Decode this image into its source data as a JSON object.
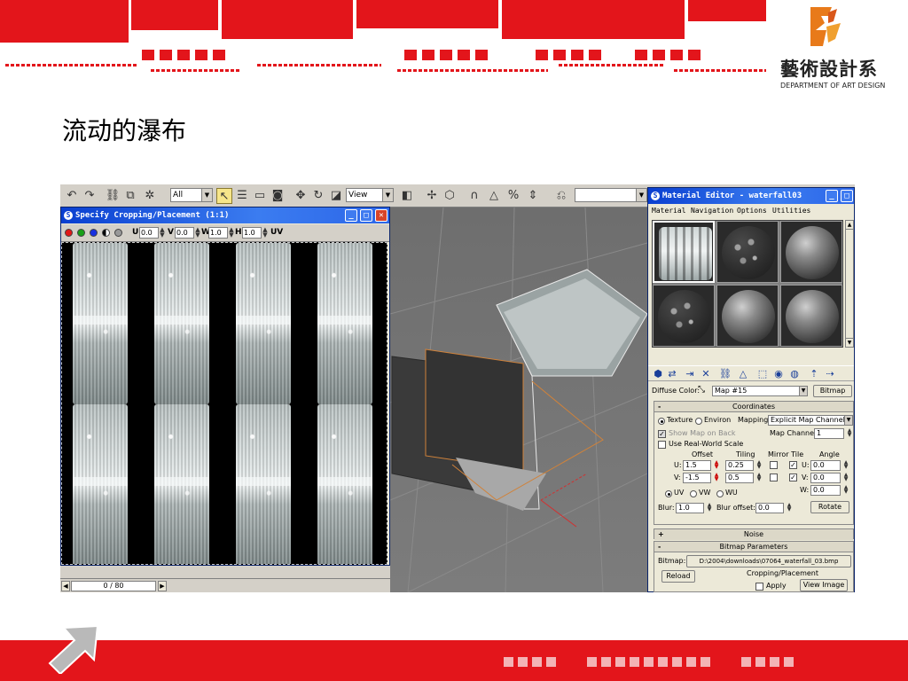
{
  "header": {
    "logo_text": "藝術設計系",
    "logo_subtitle": "DEPARTMENT OF ART DESIGN"
  },
  "slide_title": "流动的瀑布",
  "colors": {
    "brand_red": "#e3151b",
    "titlebar_blue": "#0a3fd0",
    "window_bg": "#ece9d8",
    "toolbar_bg": "#d4d0c8"
  },
  "main_toolbar": {
    "selection_filter": "All",
    "reference_coord": "View",
    "named_selection": ""
  },
  "crop_window": {
    "title": "Specify Cropping/Placement  (1:1)",
    "u_label": "U",
    "u_value": "0.0",
    "v_label": "V",
    "v_value": "0.0",
    "w_label": "W",
    "w_value": "1.0",
    "h_label": "H",
    "h_value": "1.0",
    "uv_label": "UV",
    "frame_counter": "0 / 80"
  },
  "material_editor": {
    "title": "Material Editor - waterfall03",
    "menu": [
      "Material",
      "Navigation",
      "Options",
      "Utilities"
    ],
    "diffuse_label": "Diffuse Color:",
    "map_name": "Map #15",
    "map_type": "Bitmap",
    "coordinates": {
      "header": "Coordinates",
      "texture_label": "Texture",
      "environ_label": "Environ",
      "mapping_label": "Mapping:",
      "mapping_value": "Explicit Map Channel",
      "show_map_label": "Show Map on Back",
      "map_channel_label": "Map Channel:",
      "map_channel_value": "1",
      "real_world_label": "Use Real-World Scale",
      "offset_label": "Offset",
      "tiling_label": "Tiling",
      "mirror_tile_label": "Mirror Tile",
      "angle_label": "Angle",
      "u_label": "U:",
      "v_label": "V:",
      "w_label": "W:",
      "offset_u": "1.5",
      "offset_v": "-1.5",
      "tiling_u": "0.25",
      "tiling_v": "0.5",
      "angle_u": "0.0",
      "angle_v": "0.0",
      "angle_w": "0.0",
      "uv_label": "UV",
      "vw_label": "VW",
      "wu_label": "WU",
      "blur_label": "Blur:",
      "blur_value": "1.0",
      "blur_offset_label": "Blur offset:",
      "blur_offset_value": "0.0",
      "rotate_label": "Rotate"
    },
    "noise_header": "Noise",
    "bitmap_params": {
      "header": "Bitmap Parameters",
      "bitmap_label": "Bitmap:",
      "bitmap_path": "D:\\2004\\downloads\\07064_waterfall_03.bmp",
      "reload_label": "Reload",
      "cropping_label": "Cropping/Placement",
      "apply_label": "Apply",
      "view_image_label": "View Image"
    }
  }
}
